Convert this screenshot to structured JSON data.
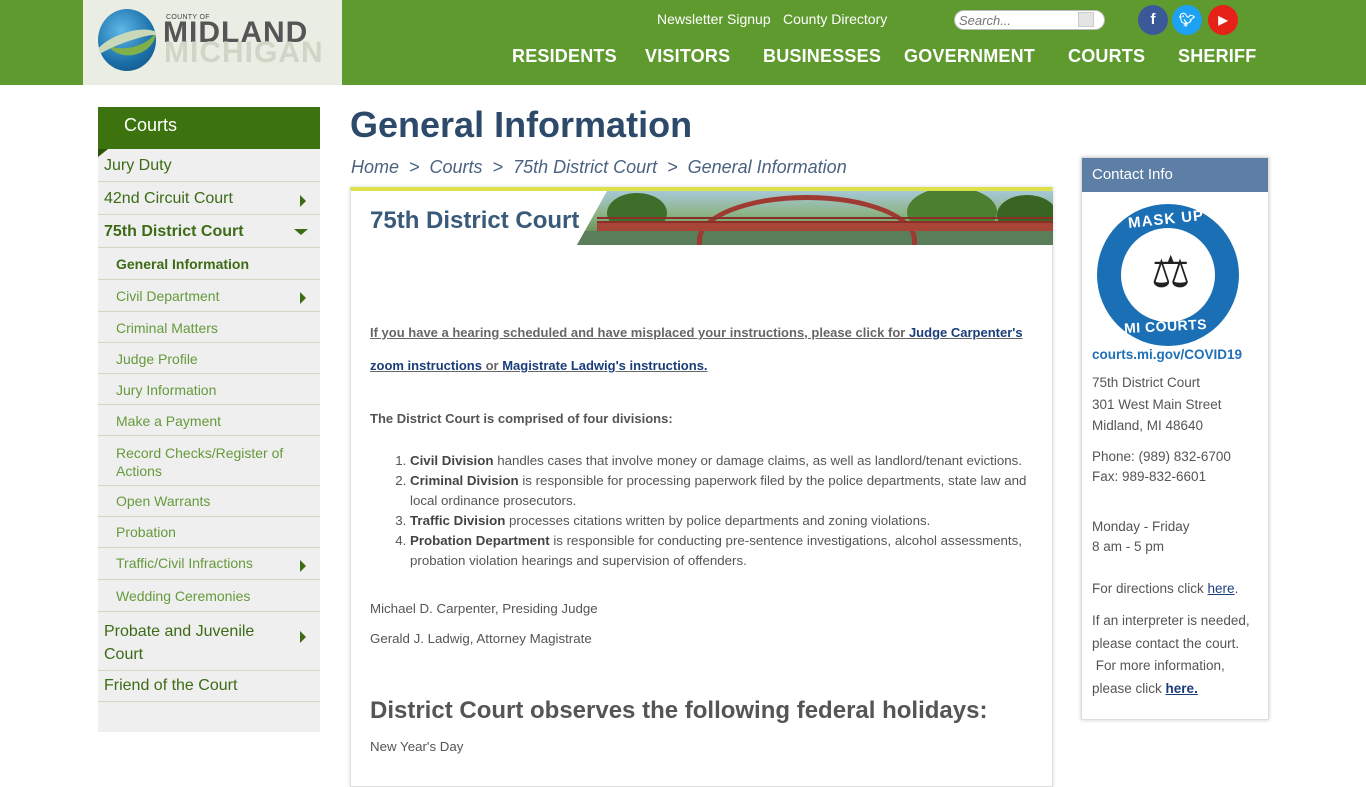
{
  "header": {
    "logo": {
      "county": "COUNTY OF",
      "name": "MIDLAND",
      "state": "MICHIGAN"
    },
    "top_links": [
      "Newsletter Signup",
      "County Directory"
    ],
    "search": {
      "placeholder": "Search..."
    },
    "social": [
      {
        "icon": "facebook-icon",
        "color": "#3b5998"
      },
      {
        "icon": "twitter-icon",
        "color": "#1da1f2"
      },
      {
        "icon": "youtube-icon",
        "color": "#e62117"
      }
    ],
    "nav": [
      "RESIDENTS",
      "VISITORS",
      "BUSINESSES",
      "GOVERNMENT",
      "COURTS",
      "SHERIFF"
    ]
  },
  "sidebar": {
    "title": "Courts",
    "items": [
      {
        "label": "Jury Duty"
      },
      {
        "label": "42nd Circuit Court",
        "expandable": true
      },
      {
        "label": "75th District Court",
        "expanded": true
      },
      {
        "label": "General Information",
        "active": true
      },
      {
        "label": "Civil Department",
        "expandable": true
      },
      {
        "label": "Criminal Matters"
      },
      {
        "label": "Judge Profile"
      },
      {
        "label": "Jury Information"
      },
      {
        "label": "Make a Payment"
      },
      {
        "label": "Record Checks/Register of Actions"
      },
      {
        "label": "Open Warrants"
      },
      {
        "label": "Probation"
      },
      {
        "label": "Traffic/Civil Infractions",
        "expandable": true
      },
      {
        "label": "Wedding Ceremonies"
      },
      {
        "label": "Probate and Juvenile Court",
        "expandable": true
      },
      {
        "label": "Friend of the Court"
      }
    ]
  },
  "main": {
    "title": "General Information",
    "breadcrumb": [
      "Home",
      "Courts",
      "75th District Court",
      "General Information"
    ],
    "breadcrumb_sep": ">",
    "panel_heading": "75th District Court",
    "notice": {
      "text1": "If you have a hearing scheduled and have misplaced your instructions, please click for ",
      "link1": "Judge Carpenter's",
      "link1b": "zoom instructions",
      "text2": " or ",
      "link2": "Magistrate Ladwig's instructions. "
    },
    "divisions_heading": "The District Court is comprised of four divisions:",
    "divisions": [
      {
        "name": "Civil Division",
        "text": " handles cases that involve money or damage claims, as well as landlord/tenant evictions."
      },
      {
        "name": "Criminal Division",
        "text": " is responsible for processing paperwork filed by the police departments, state law and local ordinance prosecutors."
      },
      {
        "name": "Traffic Division",
        "text": " processes citations written by police departments and zoning violations."
      },
      {
        "name": "Probation Department",
        "text": " is responsible for conducting pre-sentence investigations, alcohol assessments, probation violation hearings and supervision of offenders."
      }
    ],
    "judges": [
      "Michael D. Carpenter, Presiding Judge",
      "Gerald J. Ladwig, Attorney Magistrate"
    ],
    "holidays_heading": "District Court observes the following federal holidays:",
    "holidays": [
      "New Year's Day"
    ]
  },
  "contact": {
    "title": "Contact Info",
    "mask_top": "MASK UP",
    "mask_bottom": "MI COURTS",
    "covid_link": "courts.mi.gov/COVID19",
    "address": [
      "75th District Court",
      "301 West Main Street",
      "Midland, MI  48640"
    ],
    "phone": "Phone:  (989) 832-6700",
    "fax": "Fax: 989-832-6601",
    "hours_days": "Monday - Friday",
    "hours_time": "8 am - 5 pm",
    "directions_text": "For directions click ",
    "directions_link": "here",
    "interp_lines": [
      "If an interpreter is needed,",
      "please contact the court.",
      " For more information,"
    ],
    "interp_last": "please click ",
    "interp_link": "here."
  },
  "colors": {
    "header_green": "#5f9a2f",
    "sidebar_head": "#3d730f",
    "title_blue": "#2d4a6a",
    "contact_head": "#5d7fa6"
  }
}
